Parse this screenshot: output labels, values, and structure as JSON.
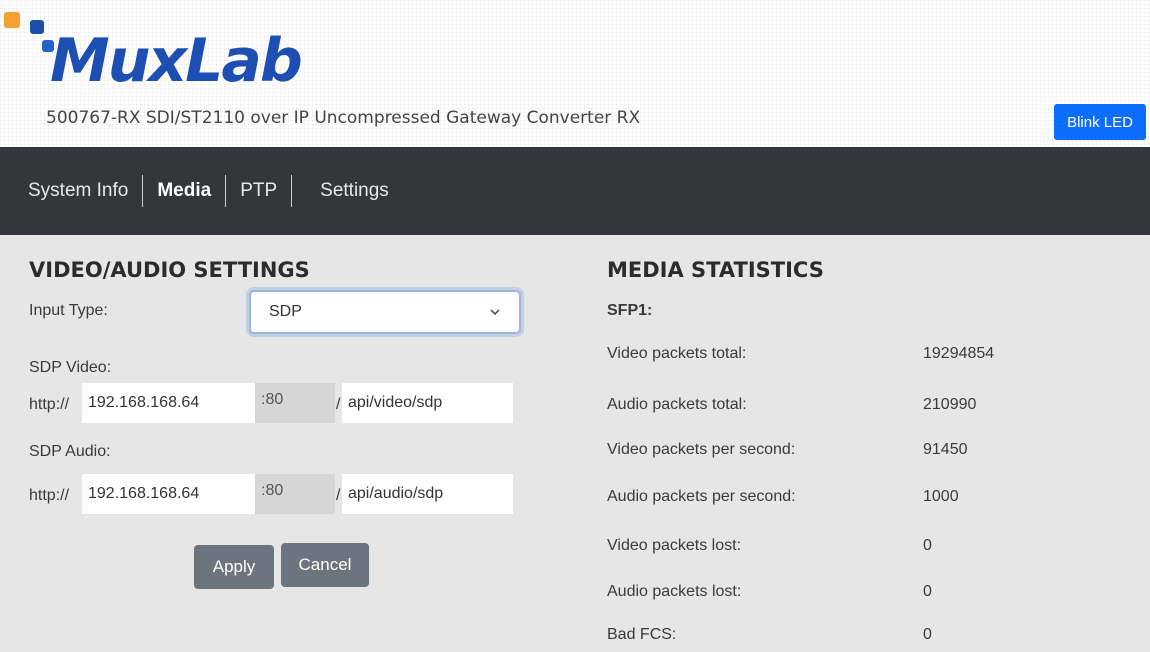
{
  "header": {
    "logo_text": "MuxLab",
    "product_name": "500767-RX SDI/ST2110 over IP Uncompressed Gateway Converter RX",
    "blink_led_label": "Blink LED"
  },
  "nav": {
    "items": [
      {
        "label": "System Info"
      },
      {
        "label": "Media",
        "active": true
      },
      {
        "label": "PTP"
      },
      {
        "label": "Settings"
      }
    ]
  },
  "video_audio": {
    "title": "VIDEO/AUDIO SETTINGS",
    "input_type_label": "Input Type:",
    "input_type_value": "SDP",
    "sdp_video": {
      "label": "SDP Video:",
      "scheme": "http://",
      "host": "192.168.168.64",
      "port_prefix": ":",
      "port": "80",
      "path_prefix": "/",
      "path": "api/video/sdp"
    },
    "sdp_audio": {
      "label": "SDP Audio:",
      "scheme": "http://",
      "host": "192.168.168.64",
      "port_prefix": ":",
      "port": "80",
      "path_prefix": "/",
      "path": "api/audio/sdp"
    },
    "apply_label": "Apply",
    "cancel_label": "Cancel"
  },
  "media_stats": {
    "title": "MEDIA STATISTICS",
    "sfp_label": "SFP1:",
    "rows": [
      {
        "label": "Video packets total:",
        "value": "19294854"
      },
      {
        "label": "Audio packets total:",
        "value": "210990"
      },
      {
        "label": "Video packets per second:",
        "value": "91450"
      },
      {
        "label": "Audio packets per second:",
        "value": "1000"
      },
      {
        "label": "Video packets lost:",
        "value": "0"
      },
      {
        "label": "Audio packets lost:",
        "value": "0"
      },
      {
        "label": "Bad FCS:",
        "value": "0"
      }
    ]
  },
  "colors": {
    "brand_blue": "#1d4fb3",
    "brand_orange": "#f5a030",
    "nav_bg": "#33363b",
    "primary_button": "#0d6efd",
    "secondary_button": "#6c757d"
  }
}
